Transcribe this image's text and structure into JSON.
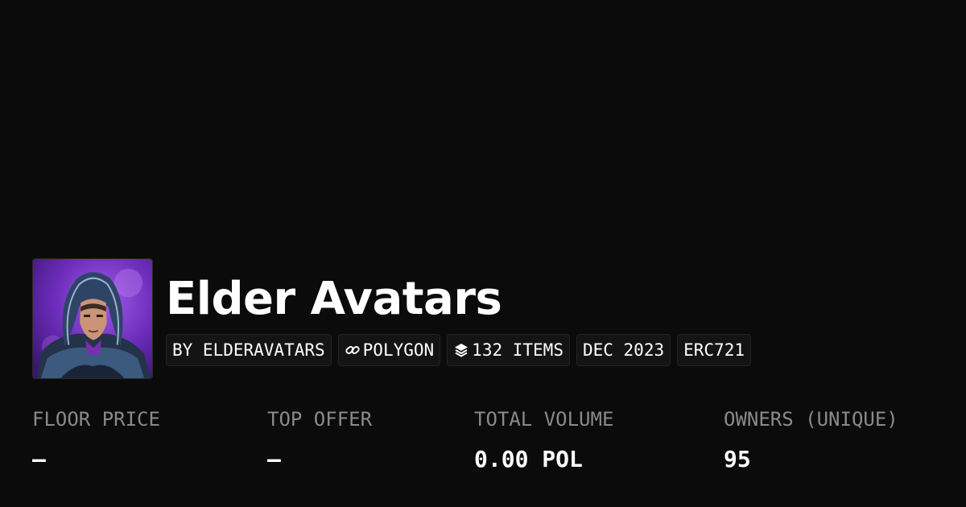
{
  "collection": {
    "name": "Elder Avatars",
    "avatar_icon": "hooded-man-portrait"
  },
  "tags": [
    {
      "label": "BY ELDERAVATARS",
      "icon": null
    },
    {
      "label": "POLYGON",
      "icon": "chain-link-icon"
    },
    {
      "label": "132 ITEMS",
      "icon": "layers-icon"
    },
    {
      "label": "DEC 2023",
      "icon": null
    },
    {
      "label": "ERC721",
      "icon": null
    }
  ],
  "stats": [
    {
      "label": "FLOOR PRICE",
      "value": "–"
    },
    {
      "label": "TOP OFFER",
      "value": "–"
    },
    {
      "label": "TOTAL VOLUME",
      "value": "0.00 POL"
    },
    {
      "label": "OWNERS (UNIQUE)",
      "value": "95"
    }
  ],
  "colors": {
    "background": "#0b0b0b",
    "tag_background": "#141414",
    "label_gray": "#8a8a8a",
    "text": "#ffffff",
    "avatar_accent": "#7a3fd0"
  }
}
